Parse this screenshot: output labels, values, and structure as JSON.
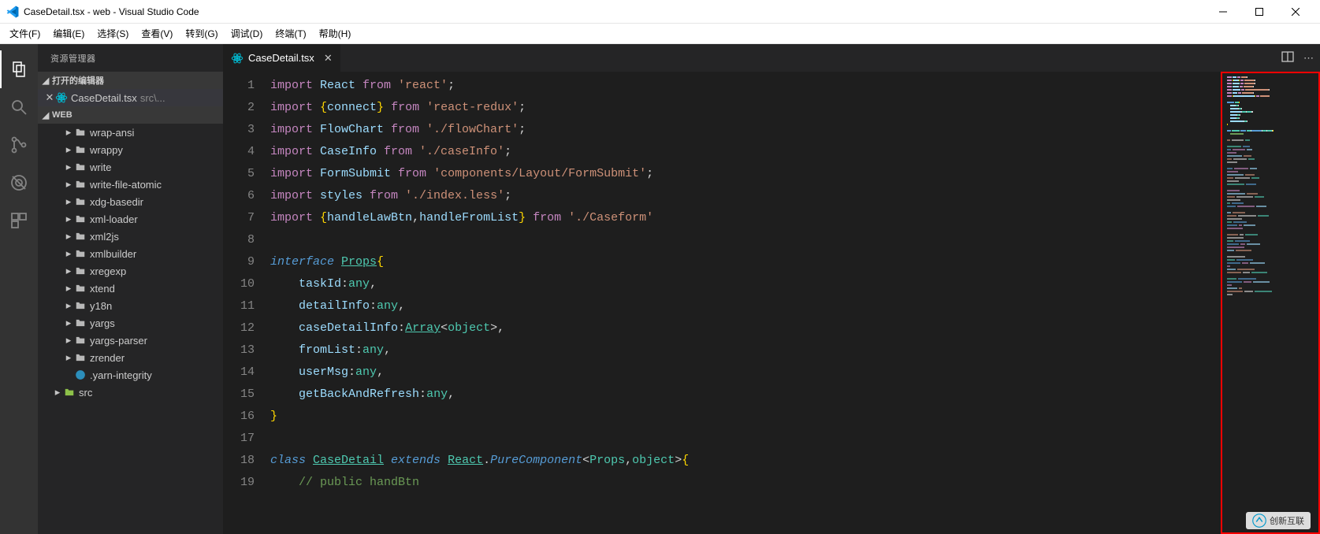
{
  "window": {
    "title": "CaseDetail.tsx - web - Visual Studio Code"
  },
  "menu": [
    "文件(F)",
    "编辑(E)",
    "选择(S)",
    "查看(V)",
    "转到(G)",
    "调试(D)",
    "终端(T)",
    "帮助(H)"
  ],
  "sidebar": {
    "title": "资源管理器",
    "openEditors": {
      "label": "打开的编辑器",
      "items": [
        {
          "name": "CaseDetail.tsx",
          "path": "src\\..."
        }
      ]
    },
    "workspace": {
      "label": "WEB",
      "tree": [
        {
          "name": "wrap-ansi",
          "type": "folder",
          "indent": 2
        },
        {
          "name": "wrappy",
          "type": "folder",
          "indent": 2
        },
        {
          "name": "write",
          "type": "folder",
          "indent": 2
        },
        {
          "name": "write-file-atomic",
          "type": "folder",
          "indent": 2
        },
        {
          "name": "xdg-basedir",
          "type": "folder",
          "indent": 2
        },
        {
          "name": "xml-loader",
          "type": "folder",
          "indent": 2
        },
        {
          "name": "xml2js",
          "type": "folder",
          "indent": 2
        },
        {
          "name": "xmlbuilder",
          "type": "folder",
          "indent": 2
        },
        {
          "name": "xregexp",
          "type": "folder",
          "indent": 2
        },
        {
          "name": "xtend",
          "type": "folder",
          "indent": 2
        },
        {
          "name": "y18n",
          "type": "folder",
          "indent": 2
        },
        {
          "name": "yargs",
          "type": "folder",
          "indent": 2
        },
        {
          "name": "yargs-parser",
          "type": "folder",
          "indent": 2
        },
        {
          "name": "zrender",
          "type": "folder",
          "indent": 2
        },
        {
          "name": ".yarn-integrity",
          "type": "yarn",
          "indent": 2
        },
        {
          "name": "src",
          "type": "src",
          "indent": 1
        }
      ]
    }
  },
  "tabs": [
    {
      "label": "CaseDetail.tsx",
      "icon": "react"
    }
  ],
  "code": {
    "lines": [
      {
        "n": 1,
        "tokens": [
          [
            "kw",
            "import "
          ],
          [
            "id",
            "React "
          ],
          [
            "kw",
            "from "
          ],
          [
            "str",
            "'react'"
          ],
          [
            "punc",
            ";"
          ]
        ]
      },
      {
        "n": 2,
        "tokens": [
          [
            "kw",
            "import "
          ],
          [
            "brace",
            "{"
          ],
          [
            "id",
            "connect"
          ],
          [
            "brace",
            "}"
          ],
          [
            "punc",
            " "
          ],
          [
            "kw",
            "from "
          ],
          [
            "str",
            "'react-redux'"
          ],
          [
            "punc",
            ";"
          ]
        ]
      },
      {
        "n": 3,
        "tokens": [
          [
            "kw",
            "import "
          ],
          [
            "id",
            "FlowChart "
          ],
          [
            "kw",
            "from "
          ],
          [
            "str",
            "'./flowChart'"
          ],
          [
            "punc",
            ";"
          ]
        ]
      },
      {
        "n": 4,
        "tokens": [
          [
            "kw",
            "import "
          ],
          [
            "id",
            "CaseInfo "
          ],
          [
            "kw",
            "from "
          ],
          [
            "str",
            "'./caseInfo'"
          ],
          [
            "punc",
            ";"
          ]
        ]
      },
      {
        "n": 5,
        "tokens": [
          [
            "kw",
            "import "
          ],
          [
            "id",
            "FormSubmit "
          ],
          [
            "kw",
            "from "
          ],
          [
            "str",
            "'components/Layout/FormSubmit'"
          ],
          [
            "punc",
            ";"
          ]
        ]
      },
      {
        "n": 6,
        "tokens": [
          [
            "kw",
            "import "
          ],
          [
            "id",
            "styles "
          ],
          [
            "kw",
            "from "
          ],
          [
            "str",
            "'./index.less'"
          ],
          [
            "punc",
            ";"
          ]
        ]
      },
      {
        "n": 7,
        "tokens": [
          [
            "kw",
            "import "
          ],
          [
            "brace",
            "{"
          ],
          [
            "id",
            "handleLawBtn"
          ],
          [
            "punc",
            ","
          ],
          [
            "id",
            "handleFromList"
          ],
          [
            "brace",
            "}"
          ],
          [
            "punc",
            " "
          ],
          [
            "kw",
            "from "
          ],
          [
            "str",
            "'./Caseform'"
          ]
        ]
      },
      {
        "n": 8,
        "tokens": []
      },
      {
        "n": 9,
        "tokens": [
          [
            "itf",
            "interface "
          ],
          [
            "type-u",
            "Props"
          ],
          [
            "brace",
            "{"
          ]
        ]
      },
      {
        "n": 10,
        "tokens": [
          [
            "punc",
            "    "
          ],
          [
            "id",
            "taskId"
          ],
          [
            "punc",
            ":"
          ],
          [
            "type",
            "any"
          ],
          [
            "punc",
            ","
          ]
        ]
      },
      {
        "n": 11,
        "tokens": [
          [
            "punc",
            "    "
          ],
          [
            "id",
            "detailInfo"
          ],
          [
            "punc",
            ":"
          ],
          [
            "type",
            "any"
          ],
          [
            "punc",
            ","
          ]
        ]
      },
      {
        "n": 12,
        "tokens": [
          [
            "punc",
            "    "
          ],
          [
            "id",
            "caseDetailInfo"
          ],
          [
            "punc",
            ":"
          ],
          [
            "type-u",
            "Array"
          ],
          [
            "punc",
            "<"
          ],
          [
            "type",
            "object"
          ],
          [
            "punc",
            ">,"
          ]
        ]
      },
      {
        "n": 13,
        "tokens": [
          [
            "punc",
            "    "
          ],
          [
            "id",
            "fromList"
          ],
          [
            "punc",
            ":"
          ],
          [
            "type",
            "any"
          ],
          [
            "punc",
            ","
          ]
        ]
      },
      {
        "n": 14,
        "tokens": [
          [
            "punc",
            "    "
          ],
          [
            "id",
            "userMsg"
          ],
          [
            "punc",
            ":"
          ],
          [
            "type",
            "any"
          ],
          [
            "punc",
            ","
          ]
        ]
      },
      {
        "n": 15,
        "tokens": [
          [
            "punc",
            "    "
          ],
          [
            "id",
            "getBackAndRefresh"
          ],
          [
            "punc",
            ":"
          ],
          [
            "type",
            "any"
          ],
          [
            "punc",
            ","
          ]
        ]
      },
      {
        "n": 16,
        "tokens": [
          [
            "brace",
            "}"
          ]
        ]
      },
      {
        "n": 17,
        "tokens": []
      },
      {
        "n": 18,
        "tokens": [
          [
            "itf",
            "class "
          ],
          [
            "type-u",
            "CaseDetail"
          ],
          [
            "punc",
            " "
          ],
          [
            "itf",
            "extends "
          ],
          [
            "type-u",
            "React"
          ],
          [
            "punc",
            "."
          ],
          [
            "kw2",
            "PureComponent"
          ],
          [
            "punc",
            "<"
          ],
          [
            "type",
            "Props"
          ],
          [
            "punc",
            ","
          ],
          [
            "type",
            "object"
          ],
          [
            "punc",
            ">"
          ],
          [
            "brace",
            "{"
          ]
        ]
      },
      {
        "n": 19,
        "tokens": [
          [
            "punc",
            "    "
          ],
          [
            "cmt",
            "// public handBtn"
          ]
        ]
      }
    ]
  },
  "watermark": "创新互联"
}
